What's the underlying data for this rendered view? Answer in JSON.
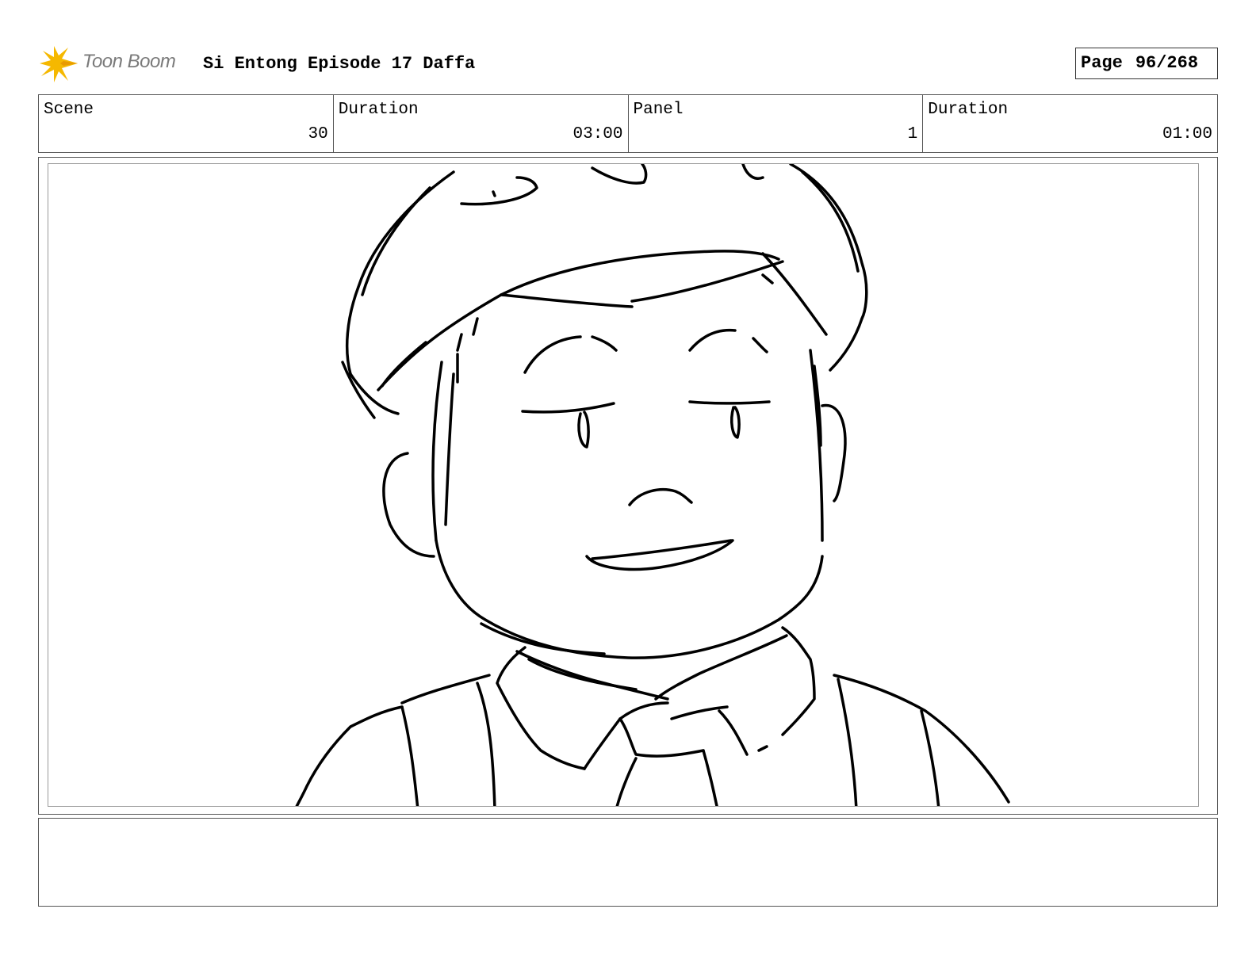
{
  "header": {
    "logo_text": "Toon Boom",
    "title": "Si Entong Episode 17 Daffa",
    "page_label": "Page",
    "page_number": "96/268"
  },
  "info": {
    "scene_label": "Scene",
    "scene_value": "30",
    "scene_duration_label": "Duration",
    "scene_duration_value": "03:00",
    "panel_label": "Panel",
    "panel_value": "1",
    "panel_duration_label": "Duration",
    "panel_duration_value": "01:00"
  },
  "notes": {
    "text": ""
  },
  "colors": {
    "logo_star": "#f5b800",
    "logo_text": "#7a7a7a",
    "border": "#555555"
  }
}
